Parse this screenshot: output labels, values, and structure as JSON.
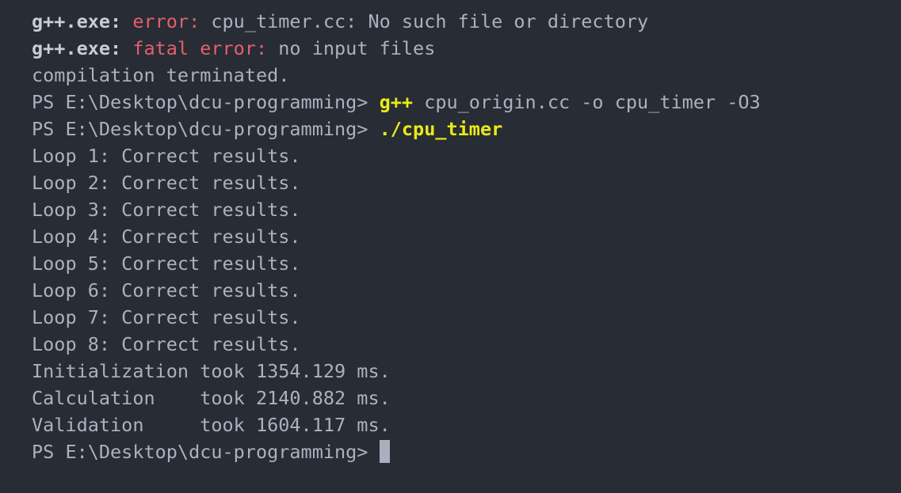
{
  "terminal": {
    "background_color": "#282c34",
    "default_text_color": "#abb2bf",
    "bright_text_color": "#c8cdd6",
    "error_color": "#e4606d",
    "command_color": "#eaea18",
    "cursor_color": "#a8b0be",
    "prompt": "PS E:\\Desktop\\dcu-programming>",
    "lines": [
      {
        "name": "gcc-error-no-such-file",
        "segments": [
          {
            "text": "g++.exe: ",
            "style": "bright"
          },
          {
            "text": "error: ",
            "style": "red"
          },
          {
            "text": "cpu_timer.cc: No such file or directory",
            "style": "default"
          }
        ]
      },
      {
        "name": "gcc-fatal-error-no-input-files",
        "segments": [
          {
            "text": "g++.exe: ",
            "style": "bright"
          },
          {
            "text": "fatal error: ",
            "style": "red"
          },
          {
            "text": "no input files",
            "style": "default"
          }
        ]
      },
      {
        "name": "compilation-terminated",
        "segments": [
          {
            "text": "compilation terminated.",
            "style": "default"
          }
        ]
      },
      {
        "name": "prompt-compile-command",
        "segments": [
          {
            "text": "PS E:\\Desktop\\dcu-programming> ",
            "style": "default"
          },
          {
            "text": "g++",
            "style": "yellow"
          },
          {
            "text": " cpu_origin.cc -o cpu_timer -O3",
            "style": "default"
          }
        ]
      },
      {
        "name": "prompt-run-command",
        "segments": [
          {
            "text": "PS E:\\Desktop\\dcu-programming> ",
            "style": "default"
          },
          {
            "text": "./cpu_timer",
            "style": "yellow"
          }
        ]
      },
      {
        "name": "loop-result-1",
        "segments": [
          {
            "text": "Loop 1: Correct results.",
            "style": "default"
          }
        ]
      },
      {
        "name": "loop-result-2",
        "segments": [
          {
            "text": "Loop 2: Correct results.",
            "style": "default"
          }
        ]
      },
      {
        "name": "loop-result-3",
        "segments": [
          {
            "text": "Loop 3: Correct results.",
            "style": "default"
          }
        ]
      },
      {
        "name": "loop-result-4",
        "segments": [
          {
            "text": "Loop 4: Correct results.",
            "style": "default"
          }
        ]
      },
      {
        "name": "loop-result-5",
        "segments": [
          {
            "text": "Loop 5: Correct results.",
            "style": "default"
          }
        ]
      },
      {
        "name": "loop-result-6",
        "segments": [
          {
            "text": "Loop 6: Correct results.",
            "style": "default"
          }
        ]
      },
      {
        "name": "loop-result-7",
        "segments": [
          {
            "text": "Loop 7: Correct results.",
            "style": "default"
          }
        ]
      },
      {
        "name": "loop-result-8",
        "segments": [
          {
            "text": "Loop 8: Correct results.",
            "style": "default"
          }
        ]
      },
      {
        "name": "timing-initialization",
        "segments": [
          {
            "text": "Initialization took 1354.129 ms.",
            "style": "default"
          }
        ]
      },
      {
        "name": "timing-calculation",
        "segments": [
          {
            "text": "Calculation    took 2140.882 ms.",
            "style": "default"
          }
        ]
      },
      {
        "name": "timing-validation",
        "segments": [
          {
            "text": "Validation     took 1604.117 ms.",
            "style": "default"
          }
        ]
      },
      {
        "name": "prompt-active",
        "cursor": true,
        "segments": [
          {
            "text": "PS E:\\Desktop\\dcu-programming> ",
            "style": "default"
          }
        ]
      }
    ],
    "timings": [
      {
        "phase": "Initialization",
        "value": 1354.129,
        "unit": "ms"
      },
      {
        "phase": "Calculation",
        "value": 2140.882,
        "unit": "ms"
      },
      {
        "phase": "Validation",
        "value": 1604.117,
        "unit": "ms"
      }
    ],
    "loop_count": 8
  }
}
